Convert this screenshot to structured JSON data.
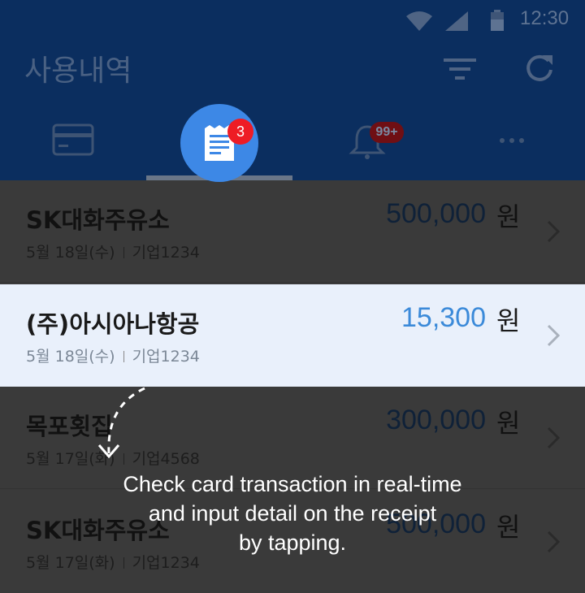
{
  "status": {
    "time": "12:30"
  },
  "header": {
    "title": "사용내역",
    "filter_icon": "filter-icon",
    "refresh_icon": "refresh-icon"
  },
  "tabs": {
    "receipt_badge": "3",
    "bell_badge": "99+"
  },
  "transactions": [
    {
      "name": "SK대화주유소",
      "date": "5월 18일(수)",
      "card": "기업1234",
      "amount": "500,000",
      "unit": "원"
    },
    {
      "name": "(주)아시아나항공",
      "date": "5월 18일(수)",
      "card": "기업1234",
      "amount": "15,300",
      "unit": "원"
    },
    {
      "name": "목포횟집",
      "date": "5월 17일(화)",
      "card": "기업4568",
      "amount": "300,000",
      "unit": "원"
    },
    {
      "name": "SK대화주유소",
      "date": "5월 17일(화)",
      "card": "기업1234",
      "amount": "500,000",
      "unit": "원"
    }
  ],
  "coach": {
    "line1": "Check card transaction in real-time",
    "line2": "and input detail on the receipt",
    "line3": "by tapping."
  },
  "colors": {
    "header_bg": "#0b2e5f",
    "accent": "#3d88e6",
    "badge": "#ee1c25",
    "amount_highlight": "#3b8ad9"
  }
}
